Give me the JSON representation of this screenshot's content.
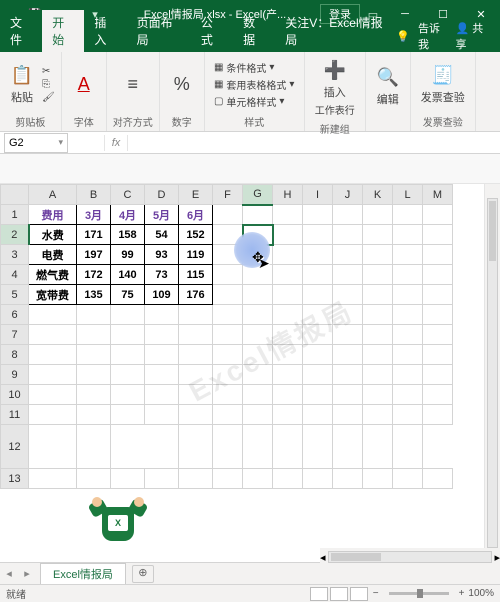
{
  "title": "Excel情报局.xlsx  -  Excel(产...",
  "login": "登录",
  "tabs": {
    "file": "文件",
    "home": "开始",
    "insert": "插入",
    "layout": "页面布局",
    "formulas": "公式",
    "data": "数据",
    "focus": "关注V：Excel情报局",
    "tellme": "告诉我",
    "share": "共享"
  },
  "ribbon": {
    "clipboard": {
      "paste": "粘贴",
      "label": "剪贴板"
    },
    "font": {
      "btn": "A",
      "label": "字体"
    },
    "align": {
      "label": "对齐方式"
    },
    "number": {
      "btn": "%",
      "label": "数字"
    },
    "styles": {
      "cond": "条件格式",
      "tbl": "套用表格格式",
      "cell": "单元格样式",
      "label": "样式"
    },
    "insert": {
      "btn": "插入",
      "sub": "工作表行",
      "label": "新建组"
    },
    "edit": {
      "btn": "编辑"
    },
    "invoice": {
      "btn": "发票查验",
      "label": "发票查验"
    }
  },
  "namebox": "G2",
  "fx": "fx",
  "cols": [
    "A",
    "B",
    "C",
    "D",
    "E",
    "F",
    "G",
    "H",
    "I",
    "J",
    "K",
    "L",
    "M"
  ],
  "rows": [
    "1",
    "2",
    "3",
    "4",
    "5",
    "6",
    "7",
    "8",
    "9",
    "10",
    "11",
    "12",
    "13"
  ],
  "table": {
    "headers": [
      "费用",
      "3月",
      "4月",
      "5月",
      "6月"
    ],
    "data": [
      [
        "水费",
        "171",
        "158",
        "54",
        "152"
      ],
      [
        "电费",
        "197",
        "99",
        "93",
        "119"
      ],
      [
        "燃气费",
        "172",
        "140",
        "73",
        "115"
      ],
      [
        "宽带费",
        "135",
        "75",
        "109",
        "176"
      ]
    ]
  },
  "sheet_tab": "Excel情报局",
  "status": {
    "ready": "就绪",
    "zoom": "100%"
  },
  "watermark": "Excel情报局",
  "superman_badge": "X"
}
